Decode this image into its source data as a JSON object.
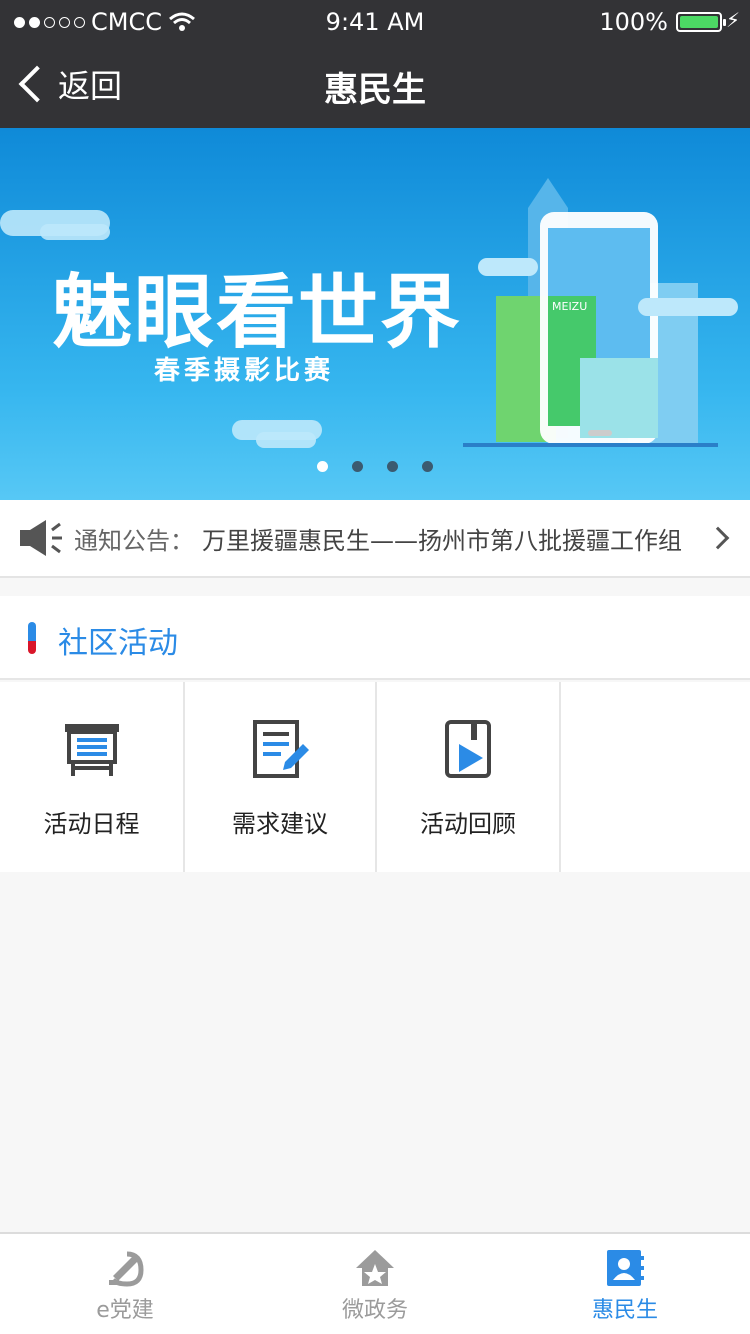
{
  "status_bar": {
    "carrier": "CMCC",
    "time": "9:41 AM",
    "battery": "100%"
  },
  "nav": {
    "back_label": "返回",
    "title": "惠民生"
  },
  "banner": {
    "headline": "魅眼看世界",
    "subline": "春季摄影比赛",
    "page_count": 4,
    "active_page": 1
  },
  "notice": {
    "label": "通知公告：",
    "text": "万里援疆惠民生——扬州市第八批援疆工作组"
  },
  "section": {
    "title": "社区活动"
  },
  "grid": [
    {
      "label": "活动日程",
      "icon": "schedule-board-icon"
    },
    {
      "label": "需求建议",
      "icon": "document-edit-icon"
    },
    {
      "label": "活动回顾",
      "icon": "video-play-icon"
    }
  ],
  "tabbar": [
    {
      "label": "e党建",
      "icon": "party-emblem-icon"
    },
    {
      "label": "微政务",
      "icon": "government-home-icon"
    },
    {
      "label": "惠民生",
      "icon": "contacts-book-icon",
      "active": true
    }
  ],
  "colors": {
    "accent": "#2b8be6",
    "nav_bg": "#333336",
    "red": "#d9162a"
  }
}
